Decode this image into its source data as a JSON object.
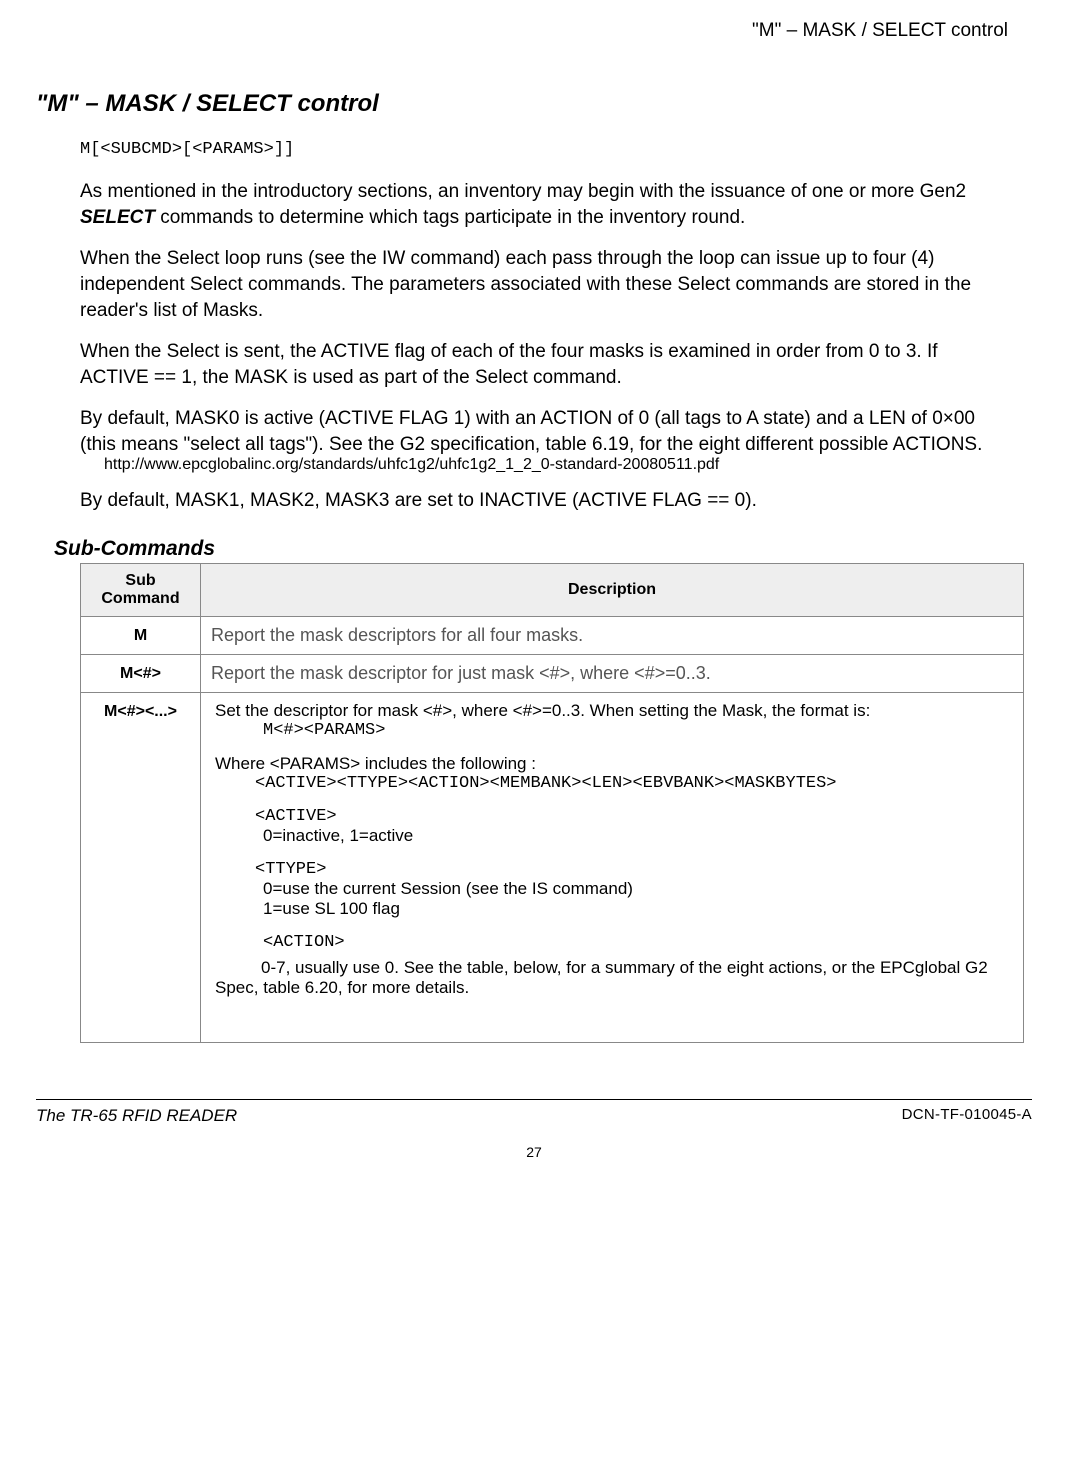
{
  "top_header": "\"M\" – MASK / SELECT control",
  "title": "\"M\" – MASK / SELECT control",
  "syntax": "M[<SUBCMD>[<PARAMS>]]",
  "p1a": "As mentioned in the introductory sections, an inventory may begin with the issuance of one or more Gen2 ",
  "p1b": "SELECT",
  "p1c": " commands to determine which tags participate in the inventory round.",
  "p2": "When the Select loop runs (see the IW command) each pass through the loop can issue up to four (4) independent Select commands. The parameters associated with these Select commands are stored in the reader's list of Masks.",
  "p3": "When the Select is sent, the ACTIVE flag of each of the four masks is examined in order from 0 to 3. If ACTIVE == 1, the MASK is used as part of the Select command.",
  "p4": "By default, MASK0 is active (ACTIVE FLAG 1) with an ACTION of 0 (all tags to A state) and a LEN of 0×00 (this means \"select all tags\"). See the G2 specification, table 6.19, for the eight different possible ACTIONS.",
  "url": "http://www.epcglobalinc.org/standards/uhfc1g2/uhfc1g2_1_2_0-standard-20080511.pdf",
  "p5": "By default, MASK1, MASK2, MASK3 are set to INACTIVE (ACTIVE FLAG == 0).",
  "sub_heading": "Sub-Commands",
  "th_sub": "Sub Command",
  "th_desc": "Description",
  "rows": [
    {
      "sub": "M",
      "desc": "Report the mask descriptors for all four masks."
    },
    {
      "sub": "M<#>",
      "desc": "Report the mask descriptor for just mask <#>, where <#>=0..3."
    }
  ],
  "row3": {
    "sub": "M<#><...>",
    "line1": "Set the descriptor for mask <#>, where <#>=0..3. When setting the Mask, the format is:",
    "line2": "M<#><PARAMS>",
    "line3": "Where <PARAMS> includes the following :",
    "line4": "<ACTIVE><TTYPE><ACTION><MEMBANK><LEN><EBVBANK><MASKBYTES>",
    "active_h": "<ACTIVE>",
    "active_t": "0=inactive, 1=active",
    "ttype_h": "<TTYPE>",
    "ttype_t1": "0=use the current Session (see the IS command)",
    "ttype_t2": "1=use SL 100 flag",
    "action_h": "<ACTION>",
    "action_t": "0-7, usually use 0. See the table, below, for a summary of the eight actions, or the EPCglobal G2 Spec, table 6.20, for more details."
  },
  "footer_left": "The TR-65 RFID READER",
  "footer_right": "DCN-TF-010045-A",
  "page_num": "27"
}
